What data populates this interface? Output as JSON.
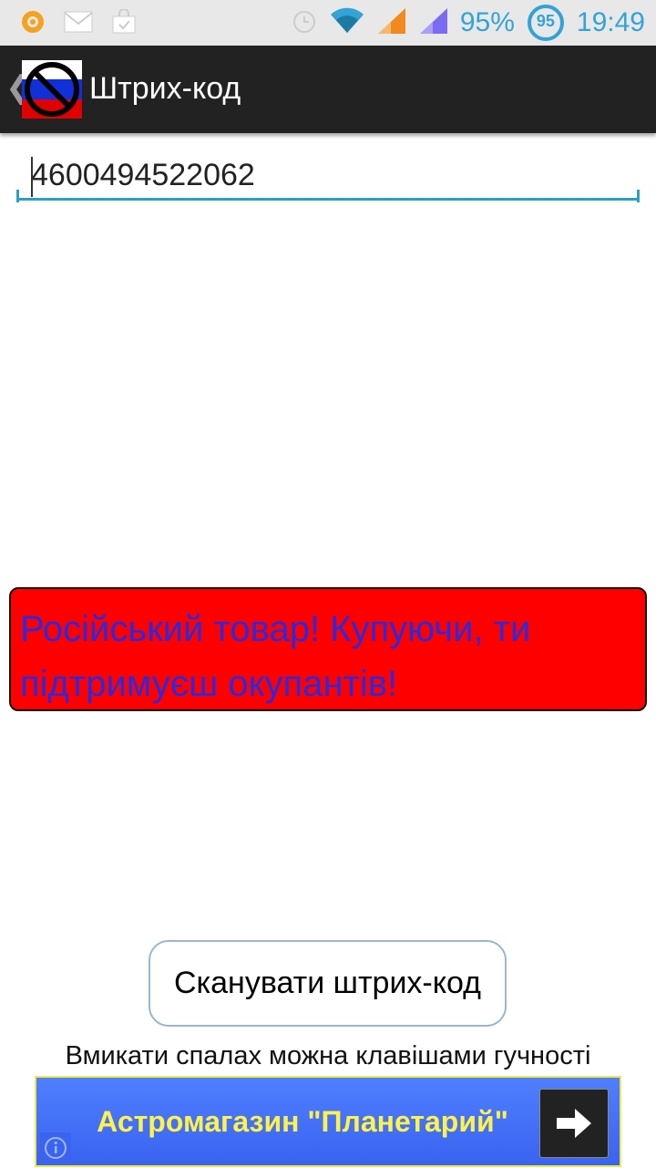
{
  "status_bar": {
    "battery_percent": "95%",
    "battery_ring_value": "95",
    "time": "19:49",
    "icons": [
      "app-notification-icon",
      "mail-icon",
      "bag-icon",
      "alarm-icon",
      "wifi-icon",
      "signal-icon",
      "signal-icon",
      "battery-ring-icon"
    ]
  },
  "action_bar": {
    "title": "Штрих-код",
    "logo": "no-russia-flag-icon"
  },
  "barcode": {
    "value": "4600494522062"
  },
  "warning": {
    "text": "Російський товар! Купуючи, ти підтримуєш окупантів!",
    "background": "#ff0000",
    "text_color": "#2a2ae0"
  },
  "scan_button": {
    "label": "Сканувати штрих-код"
  },
  "hint": {
    "text": "Вмикати спалах можна клавішами гучності"
  },
  "ad": {
    "text": "Астромагазин \"Планетарий\"",
    "background": "#3a63f0",
    "text_color": "#fff24a"
  },
  "colors": {
    "accent": "#33a3d6",
    "action_bar": "#222222"
  }
}
